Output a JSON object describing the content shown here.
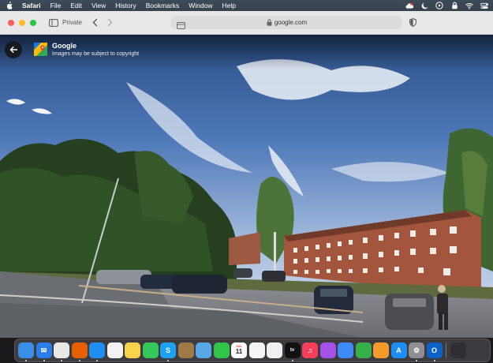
{
  "menubar": {
    "apple_icon": "apple-icon",
    "app_name": "Safari",
    "items": [
      "File",
      "Edit",
      "View",
      "History",
      "Bookmarks",
      "Window",
      "Help"
    ],
    "status_icons": [
      "creative-cloud-icon",
      "focus-moon-icon",
      "media-play-icon",
      "vpn-lock-icon",
      "wifi-icon",
      "control-center-icon"
    ]
  },
  "toolbar": {
    "private_label": "Private",
    "address": "google.com",
    "lock_icon": "lock-icon",
    "colors": {
      "close": "#ff5f57",
      "minimize": "#febc2e",
      "zoom": "#28c840"
    }
  },
  "viewer": {
    "source_title": "Google",
    "source_subtitle": "Images may be subject to copyright"
  },
  "dock": {
    "apps": [
      {
        "name": "Finder",
        "color": "#3a8ee6",
        "glyph": ""
      },
      {
        "name": "Mail",
        "color": "#2b7de9",
        "glyph": "✉"
      },
      {
        "name": "Chrome",
        "color": "#e8e8e8",
        "glyph": ""
      },
      {
        "name": "Firefox",
        "color": "#e66000",
        "glyph": ""
      },
      {
        "name": "Safari",
        "color": "#1f8ef1",
        "glyph": ""
      },
      {
        "name": "Photos",
        "color": "#f2f2f2",
        "glyph": ""
      },
      {
        "name": "Notes",
        "color": "#f7d24a",
        "glyph": ""
      },
      {
        "name": "Messages",
        "color": "#34c759",
        "glyph": ""
      },
      {
        "name": "Skype",
        "color": "#1da1f2",
        "glyph": "S"
      },
      {
        "name": "Archive",
        "color": "#a07a45",
        "glyph": ""
      },
      {
        "name": "Maps",
        "color": "#5aa7e8",
        "glyph": ""
      },
      {
        "name": "FaceTime",
        "color": "#30c548",
        "glyph": ""
      },
      {
        "name": "Calendar",
        "color": "#ffffff",
        "glyph": "11"
      },
      {
        "name": "Reminders",
        "color": "#f5f5f5",
        "glyph": ""
      },
      {
        "name": "Freeform",
        "color": "#f0f0f0",
        "glyph": ""
      },
      {
        "name": "Apple TV",
        "color": "#111111",
        "glyph": "tv"
      },
      {
        "name": "Music",
        "color": "#fa3d5a",
        "glyph": "♫"
      },
      {
        "name": "Podcasts",
        "color": "#a550e6",
        "glyph": ""
      },
      {
        "name": "Keynote",
        "color": "#3d8af7",
        "glyph": ""
      },
      {
        "name": "Numbers",
        "color": "#36b14a",
        "glyph": ""
      },
      {
        "name": "Pages",
        "color": "#f79a2b",
        "glyph": ""
      },
      {
        "name": "App Store",
        "color": "#1c8ef6",
        "glyph": "A"
      },
      {
        "name": "System Settings",
        "color": "#8e8e93",
        "glyph": "⚙"
      },
      {
        "name": "Outlook",
        "color": "#0b63c7",
        "glyph": "O"
      },
      {
        "name": "Apps Grid",
        "color": "#2f2f33",
        "glyph": ""
      }
    ],
    "calendar_month": "JUL"
  }
}
